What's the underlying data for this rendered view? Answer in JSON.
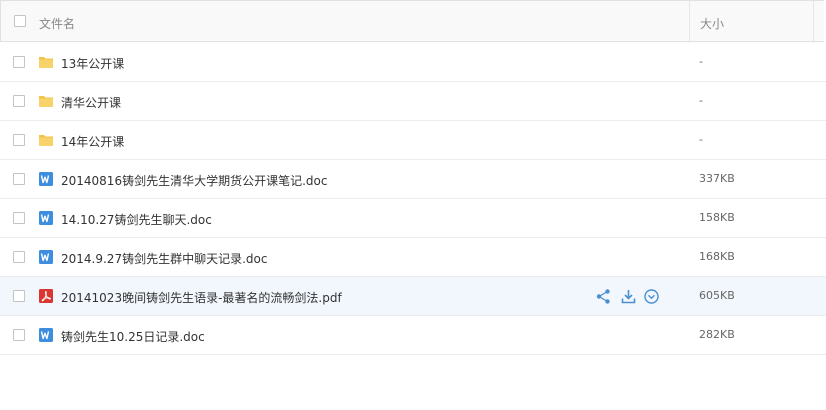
{
  "header": {
    "name_label": "文件名",
    "size_label": "大小"
  },
  "rows": [
    {
      "type": "folder",
      "name": "13年公开课",
      "size": "-"
    },
    {
      "type": "folder",
      "name": "清华公开课",
      "size": "-"
    },
    {
      "type": "folder",
      "name": "14年公开课",
      "size": "-"
    },
    {
      "type": "doc",
      "name": "20140816铸剑先生清华大学期货公开课笔记.doc",
      "size": "337KB"
    },
    {
      "type": "doc",
      "name": "14.10.27铸剑先生聊天.doc",
      "size": "158KB"
    },
    {
      "type": "doc",
      "name": "2014.9.27铸剑先生群中聊天记录.doc",
      "size": "168KB"
    },
    {
      "type": "pdf",
      "name": "20141023晚间铸剑先生语录-最著名的流畅剑法.pdf",
      "size": "605KB",
      "hovered": true,
      "actions": [
        "share-icon",
        "download-icon",
        "more-dropdown-icon"
      ]
    },
    {
      "type": "doc",
      "name": "铸剑先生10.25日记录.doc",
      "size": "282KB"
    }
  ],
  "colors": {
    "folder": "#f3c24a",
    "doc": "#3e8ee0",
    "pdf": "#d9372f",
    "action": "#4a8fcf",
    "hover_row": "#f2f7fd"
  }
}
